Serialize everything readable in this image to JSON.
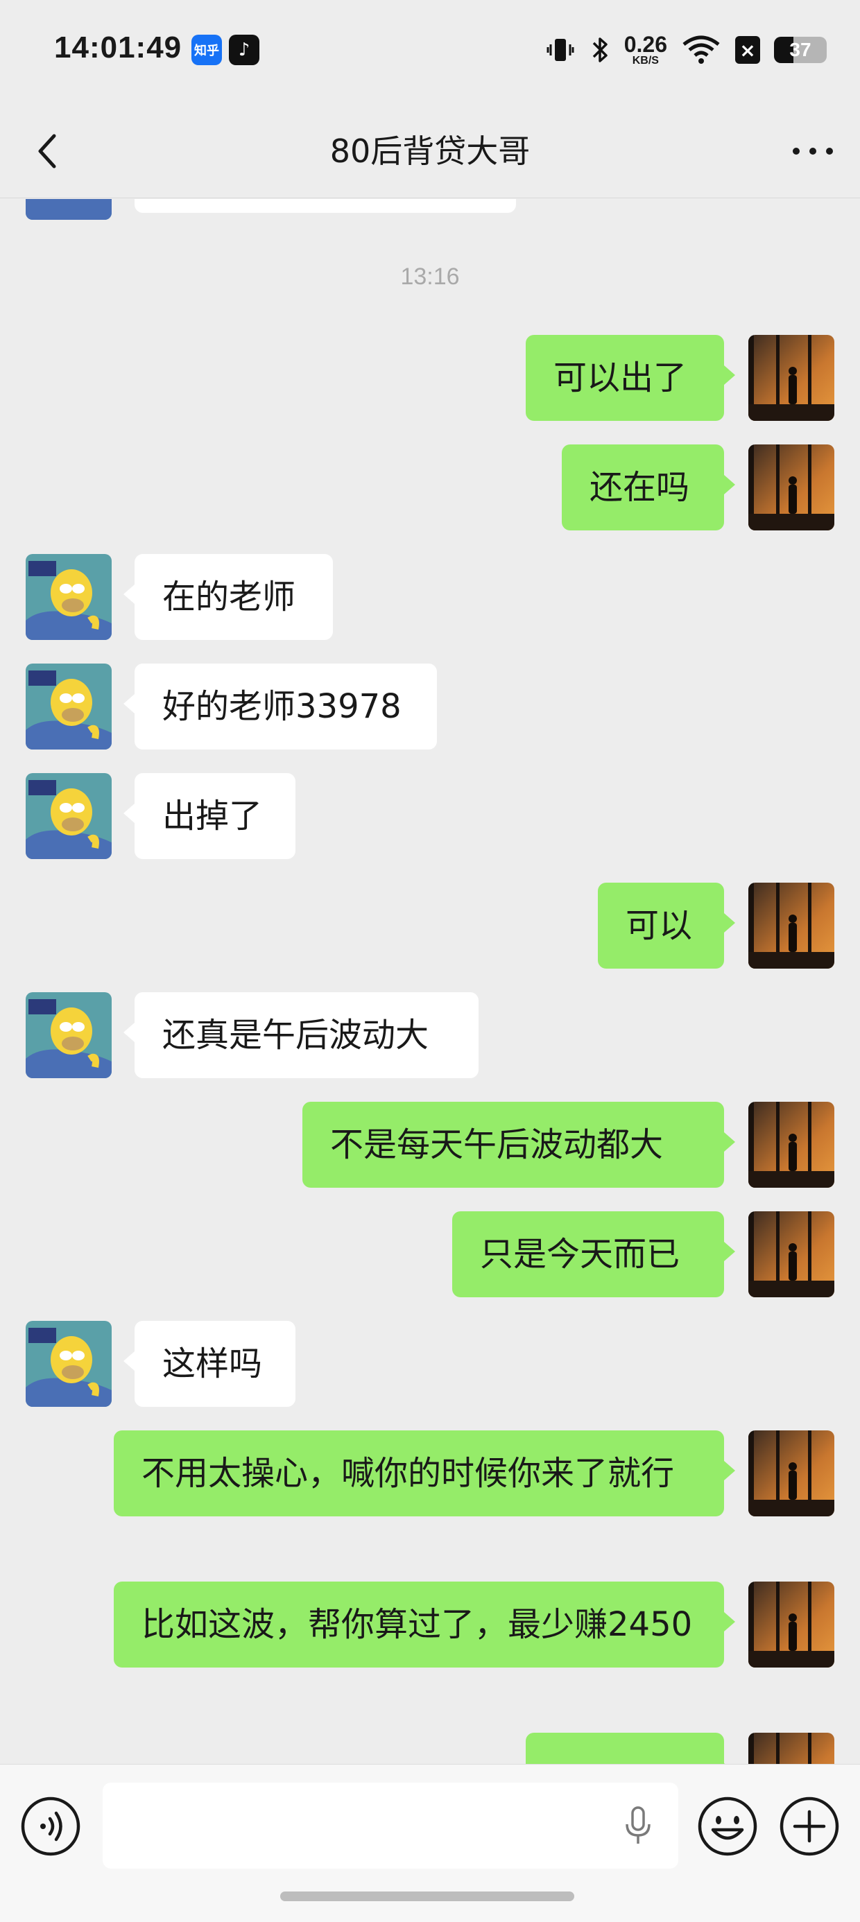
{
  "status_bar": {
    "time": "14:01:49",
    "zhihu_label": "知乎",
    "net_speed_value": "0.26",
    "net_speed_unit": "KB/S",
    "battery": "37",
    "battery_level": 0.37
  },
  "header": {
    "title": "80后背贷大哥",
    "back_icon": "chevron-left-icon",
    "more_icon": "more-dots-icon"
  },
  "chat": {
    "timestamp": "13:16",
    "messages": [
      {
        "side": "out",
        "text": "可以出了"
      },
      {
        "side": "out",
        "text": "还在吗"
      },
      {
        "side": "in",
        "text": "在的老师"
      },
      {
        "side": "in",
        "text": "好的老师33978"
      },
      {
        "side": "in",
        "text": "出掉了"
      },
      {
        "side": "out",
        "text": "可以"
      },
      {
        "side": "in",
        "text": "还真是午后波动大"
      },
      {
        "side": "out",
        "text": "不是每天午后波动都大"
      },
      {
        "side": "out",
        "text": "只是今天而已"
      },
      {
        "side": "in",
        "text": "这样吗"
      },
      {
        "side": "out",
        "text": "不用太操心，喊你的时候你来了就行"
      },
      {
        "side": "out",
        "text": "比如这波，帮你算过了，最少赚2450"
      }
    ]
  },
  "input_bar": {
    "voice_icon": "voice-icon",
    "mic_icon": "microphone-icon",
    "emoji_icon": "emoji-icon",
    "plus_icon": "plus-circle-icon",
    "placeholder": ""
  },
  "colors": {
    "outgoing_bubble": "#95ec69",
    "incoming_bubble": "#ffffff",
    "background": "#ededed"
  }
}
